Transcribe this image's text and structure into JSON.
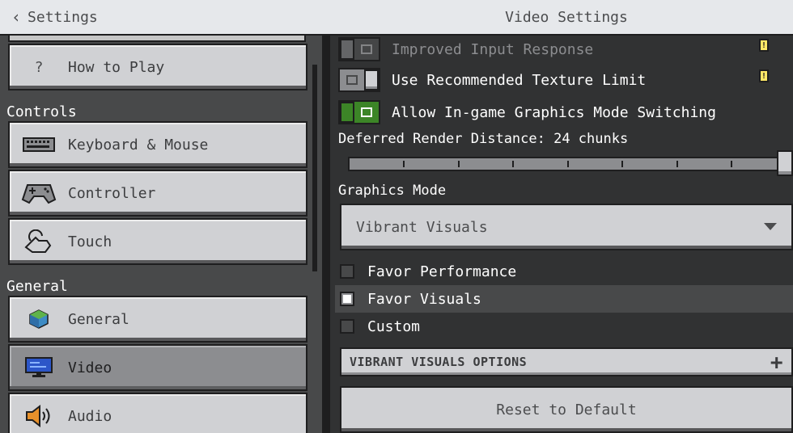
{
  "header": {
    "back_label": "Settings",
    "title": "Video Settings"
  },
  "sidebar": {
    "top_item": {
      "icon": "question-icon",
      "glyph": "?",
      "label": "How to Play"
    },
    "sections": [
      {
        "label": "Controls",
        "items": [
          {
            "icon": "keyboard-icon",
            "label": "Keyboard & Mouse"
          },
          {
            "icon": "gamepad-icon",
            "label": "Controller"
          },
          {
            "icon": "touch-icon",
            "label": "Touch"
          }
        ]
      },
      {
        "label": "General",
        "items": [
          {
            "icon": "globe-icon",
            "label": "General"
          },
          {
            "icon": "monitor-icon",
            "label": "Video",
            "selected": true
          },
          {
            "icon": "speaker-icon",
            "label": "Audio"
          }
        ]
      }
    ]
  },
  "settings": {
    "improved_input": {
      "label": "Improved Input Response",
      "state": "disabled"
    },
    "texture_limit": {
      "label": "Use Recommended Texture Limit",
      "state": "off"
    },
    "graphics_switch": {
      "label": "Allow In-game Graphics Mode Switching",
      "state": "on"
    },
    "deferred_distance": {
      "label": "Deferred Render Distance: 24 chunks",
      "value_fraction": 1.0
    },
    "graphics_mode": {
      "label": "Graphics Mode",
      "selected": "Vibrant Visuals"
    },
    "radio_options": [
      {
        "label": "Favor Performance",
        "checked": false
      },
      {
        "label": "Favor Visuals",
        "checked": true
      },
      {
        "label": "Custom",
        "checked": false
      }
    ],
    "vibrant_options_label": "VIBRANT VISUALS OPTIONS",
    "reset_label": "Reset to Default"
  },
  "colors": {
    "toggle_on": "#3c8527",
    "panel_bg": "#313233",
    "sidebar_bg": "#48494a",
    "button_face": "#d0d1d4",
    "selected_face": "#8c8d90"
  }
}
